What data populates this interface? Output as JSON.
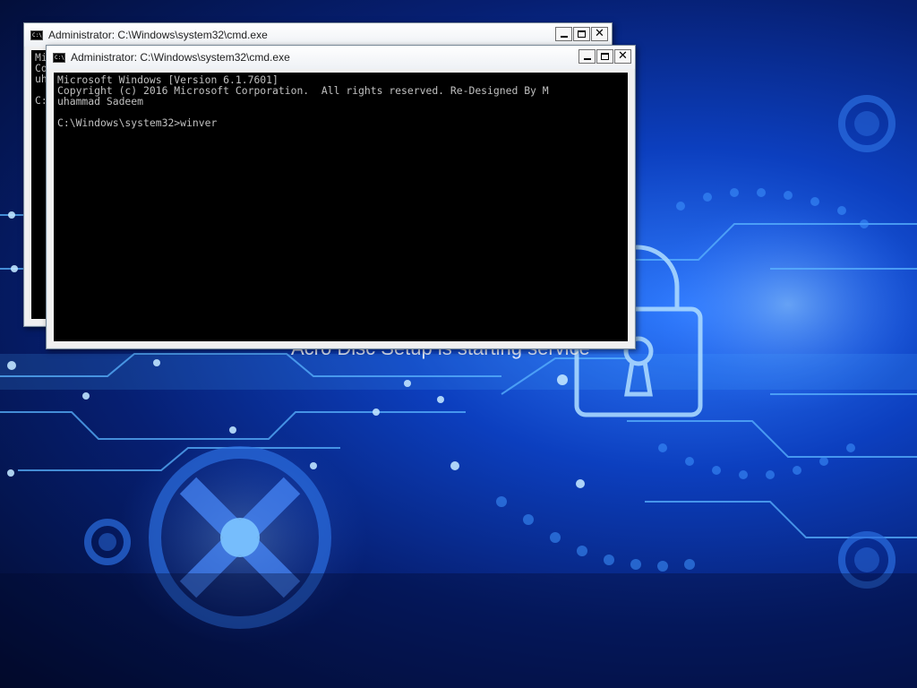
{
  "desktop": {
    "background_text": "Acro Disc Setup is starting service"
  },
  "windows": [
    {
      "id": "back",
      "title": "Administrator: C:\\Windows\\system32\\cmd.exe",
      "icon_label": "C:\\.",
      "console_text": "Mi\nCo\nuh\n\nC:"
    },
    {
      "id": "front",
      "title": "Administrator: C:\\Windows\\system32\\cmd.exe",
      "icon_label": "C:\\.",
      "console_text": "Microsoft Windows [Version 6.1.7601]\nCopyright (c) 2016 Microsoft Corporation.  All rights reserved. Re-Designed By M\nuhammad Sadeem\n\nC:\\Windows\\system32>winver"
    }
  ],
  "controls": {
    "minimize_icon": "minimize-icon",
    "maximize_icon": "maximize-icon",
    "close_glyph": "✕"
  },
  "colors": {
    "console_bg": "#000000",
    "console_fg": "#c0c0c0",
    "wallpaper_blue": "#0c3fbf"
  }
}
